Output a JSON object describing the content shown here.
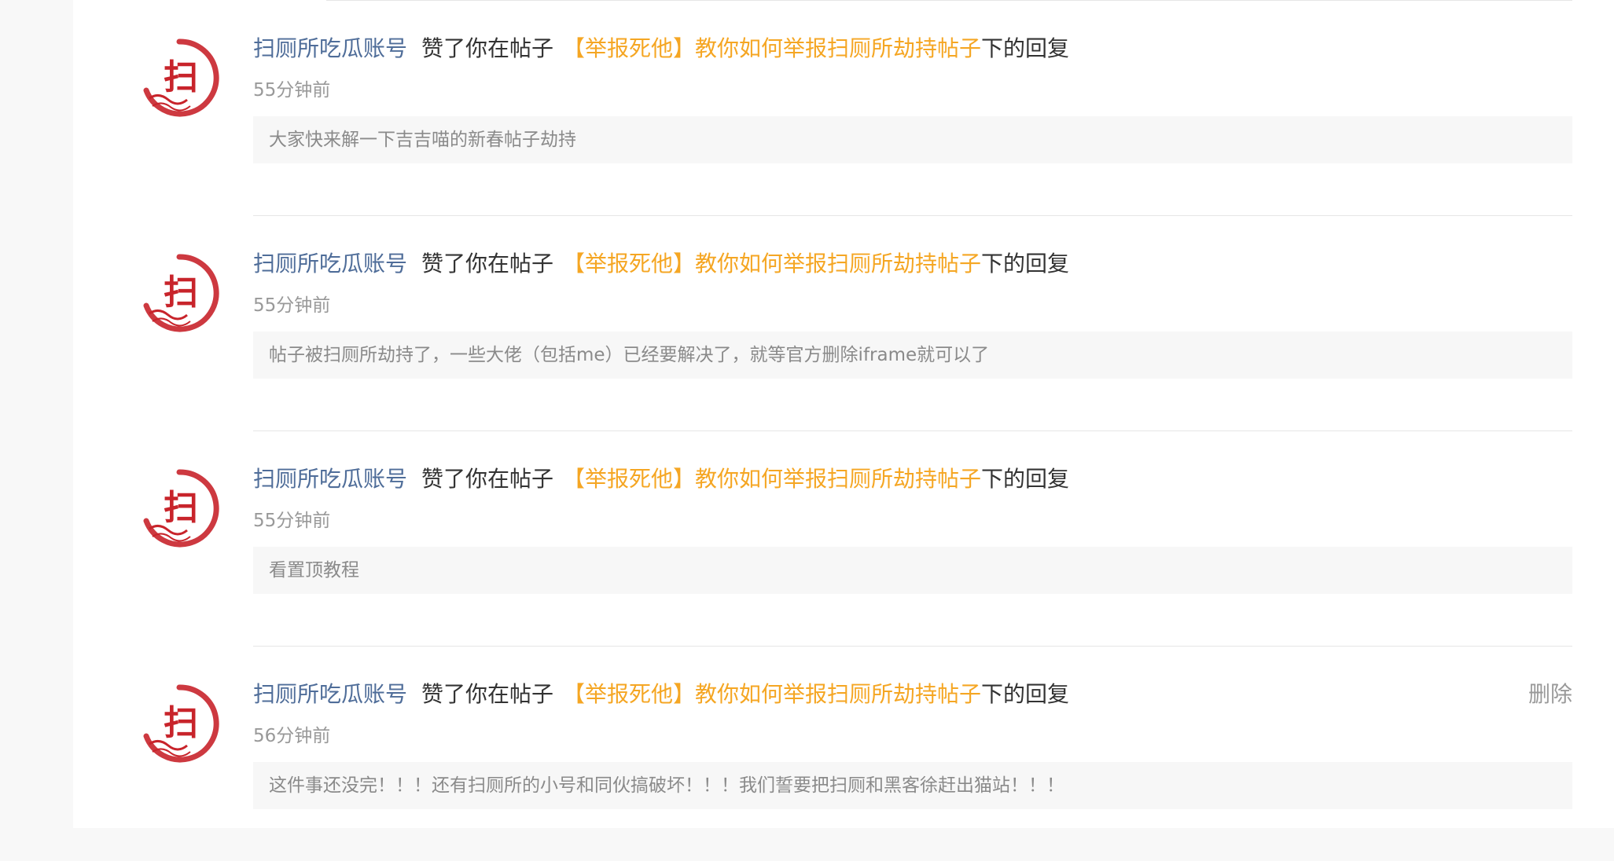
{
  "colors": {
    "user_link": "#4f6d99",
    "post_link": "#f5a623",
    "avatar_red": "#c8242b"
  },
  "avatar_icon": "sao-seal-avatar",
  "avatar_glyph": "扫",
  "notifications": [
    {
      "user": "扫厕所吃瓜账号",
      "action": "赞了你在帖子",
      "post_title": "【举报死他】教你如何举报扫厕所劫持帖子",
      "suffix": "下的回复",
      "time": "55分钟前",
      "content": "大家快来解一下吉吉喵的新春帖子劫持"
    },
    {
      "user": "扫厕所吃瓜账号",
      "action": "赞了你在帖子",
      "post_title": "【举报死他】教你如何举报扫厕所劫持帖子",
      "suffix": "下的回复",
      "time": "55分钟前",
      "content": "帖子被扫厕所劫持了，一些大佬（包括me）已经要解决了，就等官方删除iframe就可以了"
    },
    {
      "user": "扫厕所吃瓜账号",
      "action": "赞了你在帖子",
      "post_title": "【举报死他】教你如何举报扫厕所劫持帖子",
      "suffix": "下的回复",
      "time": "55分钟前",
      "content": "看置顶教程"
    },
    {
      "user": "扫厕所吃瓜账号",
      "action": "赞了你在帖子",
      "post_title": "【举报死他】教你如何举报扫厕所劫持帖子",
      "suffix": "下的回复",
      "time": "56分钟前",
      "content": "这件事还没完！！！还有扫厕所的小号和同伙搞破坏！！！我们誓要把扫厕和黑客徐赶出猫站！！！",
      "delete_label": "删除"
    }
  ]
}
